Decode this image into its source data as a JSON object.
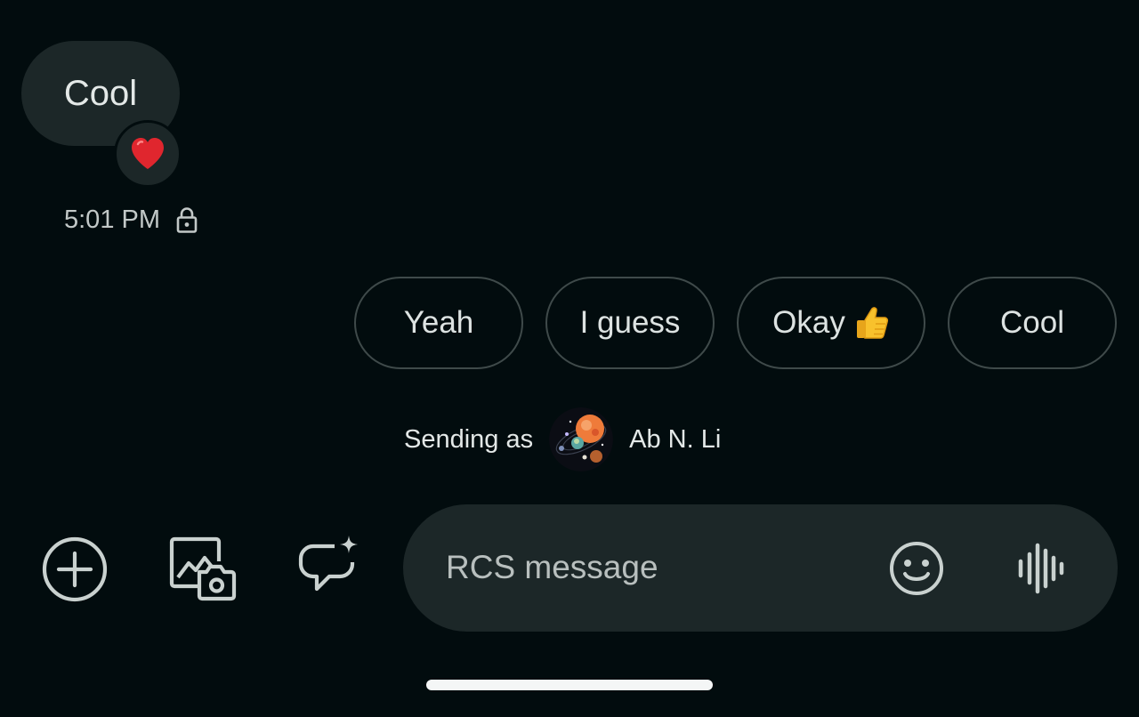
{
  "conversation": {
    "last_message": {
      "text": "Cool",
      "reaction": "heart-emoji",
      "time": "5:01 PM",
      "encryption_icon": "lock-icon"
    }
  },
  "smart_replies": [
    {
      "label": "Yeah"
    },
    {
      "label": "I guess"
    },
    {
      "label": "Okay",
      "emoji": "thumbs-up-emoji"
    },
    {
      "label": "Cool"
    }
  ],
  "sender": {
    "prefix": "Sending as",
    "name": "Ab N. Li",
    "avatar": "planets-avatar"
  },
  "toolbar": {
    "icons": [
      "add-circle-icon",
      "gallery-camera-icon",
      "ai-sparkle-chat-icon"
    ]
  },
  "compose": {
    "placeholder": "RCS message",
    "value": "",
    "buttons": [
      "emoji-icon",
      "voice-waveform-icon"
    ]
  },
  "colors": {
    "background": "#020c0e",
    "bubble": "#1c2728",
    "chip_border": "#3f4a4a",
    "text": "#e3e8e7",
    "icon": "#c9d1cf"
  }
}
